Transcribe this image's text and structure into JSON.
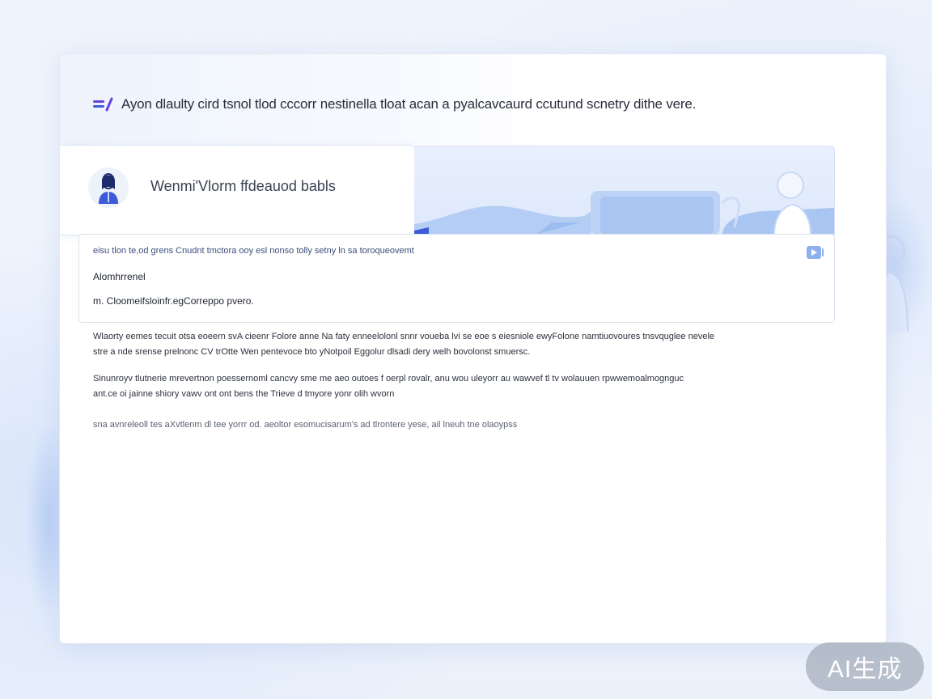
{
  "header": {
    "logo_mark": "A",
    "headline": "Ayon dlaulty cird tsnol tlod cccorr nestinella tloat acan a pyalcavcaurd ccutund scnetry dithe vere."
  },
  "profile": {
    "title": "Wenmi'Vlorm ffdeauod babls"
  },
  "info_panel": {
    "line1": "eisu tlon  te,od grens  Cnudnt  tmctora ooy esl nonso tolly setny ln sa  toroqueovemt",
    "line2": "Alomhrrenel",
    "line3": "m. Cloomeifsloinfr.egCorreppo pvero."
  },
  "body": {
    "p1_line1": "Wlaorty eemes  tecuit otsa eoeern svA cieenr Folore anne Na faty enneelolonl snnr voueba lvi se eoe s eiesniole ewyFolone namtiuovoures tnsvquglee nevele",
    "p1_line2": "stre a nde srense prelnonc CV trOtte  Wen pentevoce bto yNotpoil  Eggolur dlsadi dery welh bovolonst smuersc.",
    "p2_line1": "Sinunroyv tlutnerie mrevertnon poessernoml cancvy sme  me aeo outoes f oerpl rovalr, anu wou uleyorr au wawvef tl tv wolauuen rpwwemoalmognguc",
    "p2_line2": "ant.ce oi jainne shiory vawv ont ont  bens  the Trieve d tmyore yonr olih wvorn",
    "p3_line1": "sna  avnreleoll tes aXvtlenm dl tee yorrr od. aeoltor esomucisarum's ad tlrontere yese, ail lneuh tne olaoypss"
  },
  "badge": {
    "label": "AI生成"
  },
  "colors": {
    "accent": "#3b5bd9",
    "accent_purple": "#6a3fe0",
    "banner_blue": "#a9c6f3"
  }
}
